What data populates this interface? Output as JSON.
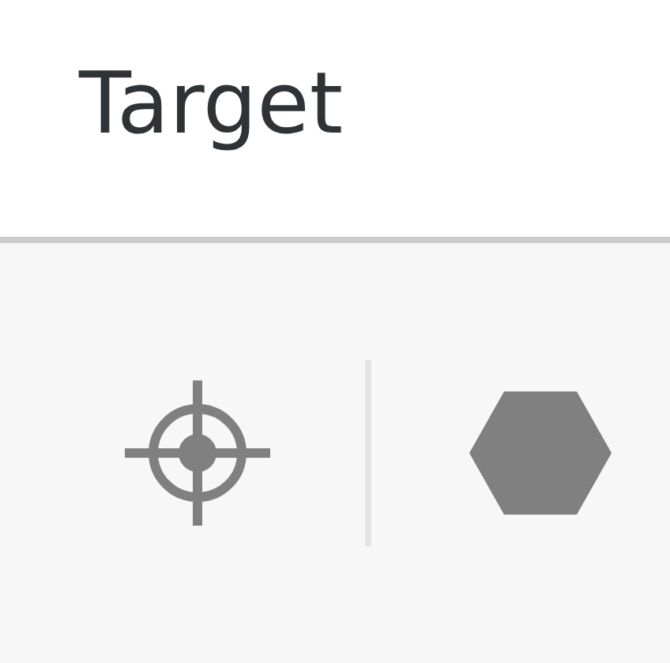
{
  "title": "Target"
}
